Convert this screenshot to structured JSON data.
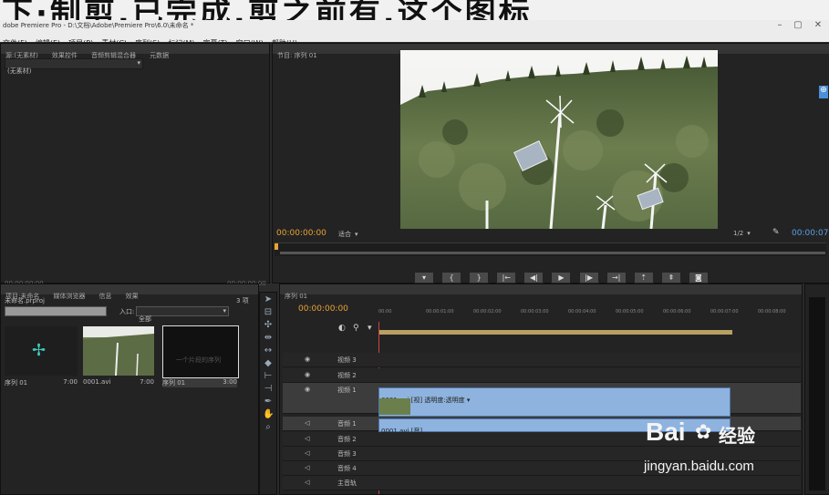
{
  "overlay": {
    "text": "下·制剪,已完成,剪之前有,这个图标"
  },
  "window": {
    "title": "dobe Premiere Pro - D:\\文档\\Adobe\\Premiere Pro\\6.0\\未命名 *",
    "min_label": "–",
    "max_label": "▢",
    "close_label": "✕"
  },
  "menu": [
    "文件(F)",
    "编辑(E)",
    "项目(P)",
    "素材(C)",
    "序列(S)",
    "标记(M)",
    "字幕(T)",
    "窗口(W)",
    "帮助(H)"
  ],
  "source_panel": {
    "tabs": [
      "源:(无素材)",
      "效果控件",
      "音频剪辑混合器",
      "元数据"
    ],
    "dropdown_label": "(无素材)",
    "footer_left": "00:00:00:00",
    "footer_right": "00:00:00:00"
  },
  "program_monitor": {
    "tab": "节目: 序列 01",
    "timecode": "00:00:00:00",
    "fit_label": "适合",
    "quality_label": "1/2",
    "duration": "00:00:07"
  },
  "project_panel": {
    "tabs": [
      "项目:未命名",
      "媒体浏览器",
      "信息",
      "效果"
    ],
    "filename": "未命名.prproj",
    "item_count": "3 项",
    "in_label": "入口:",
    "in_value": "全部",
    "items": [
      {
        "name": "序列 01",
        "duration": "7:00"
      },
      {
        "name": "0001.avi",
        "duration": "7:00"
      },
      {
        "name": "序列 01",
        "duration": "3:00"
      }
    ],
    "thumb3_caption": "一个片段的序列"
  },
  "timeline": {
    "tab": "序列 01",
    "timecode": "00:00:00:00",
    "ruler": [
      "00:00",
      "00:00:01:00",
      "00:00:02:00",
      "00:00:03:00",
      "00:00:04:00",
      "00:00:05:00",
      "00:00:06:00",
      "00:00:07:00",
      "00:00:08:00"
    ],
    "tracks": [
      {
        "name": "视频 3"
      },
      {
        "name": "视频 2"
      },
      {
        "name": "视频 1"
      },
      {
        "name": "音频 1"
      },
      {
        "name": "音频 2"
      },
      {
        "name": "音频 3"
      },
      {
        "name": "音频 4"
      },
      {
        "name": "主音轨"
      }
    ],
    "video_clip": "0001.avi [视] 透明度:透明度 ▾",
    "audio_clip": "0001.avi [音]"
  },
  "watermark": {
    "logo": "Bai",
    "logo2": "经验",
    "url": "jingyan.baidu.com"
  },
  "colors": {
    "accent_timecode": "#e8a335",
    "clip_blue": "#8fb3df",
    "panel_bg": "#232323"
  }
}
